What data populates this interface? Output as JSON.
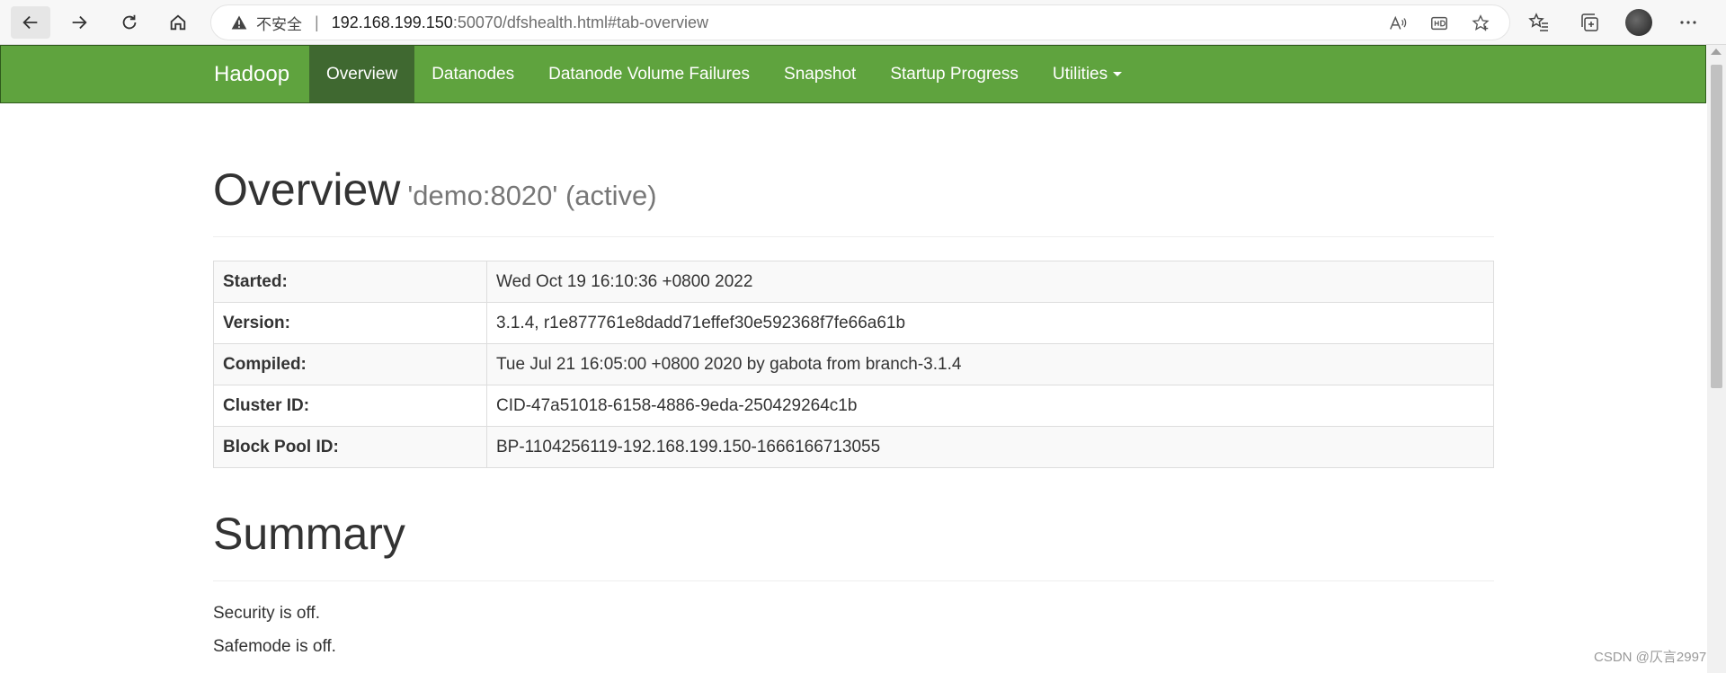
{
  "browser": {
    "security_label": "不安全",
    "separator": "|",
    "url_host": "192.168.199.150",
    "url_rest": ":50070/dfshealth.html#tab-overview"
  },
  "navbar": {
    "brand": "Hadoop",
    "items": [
      {
        "label": "Overview",
        "active": true
      },
      {
        "label": "Datanodes"
      },
      {
        "label": "Datanode Volume Failures"
      },
      {
        "label": "Snapshot"
      },
      {
        "label": "Startup Progress"
      },
      {
        "label": "Utilities"
      }
    ],
    "color": "#5fa33e",
    "active_color": "#3f6830"
  },
  "overview": {
    "title": "Overview",
    "subtitle": "'demo:8020' (active)",
    "rows": [
      {
        "key": "Started:",
        "value": "Wed Oct 19 16:10:36 +0800 2022"
      },
      {
        "key": "Version:",
        "value": "3.1.4, r1e877761e8dadd71effef30e592368f7fe66a61b"
      },
      {
        "key": "Compiled:",
        "value": "Tue Jul 21 16:05:00 +0800 2020 by gabota from branch-3.1.4"
      },
      {
        "key": "Cluster ID:",
        "value": "CID-47a51018-6158-4886-9eda-250429264c1b"
      },
      {
        "key": "Block Pool ID:",
        "value": "BP-1104256119-192.168.199.150-1666166713055"
      }
    ]
  },
  "summary": {
    "title": "Summary",
    "security": "Security is off.",
    "safemode": "Safemode is off."
  },
  "watermark": "CSDN @仄言2997"
}
